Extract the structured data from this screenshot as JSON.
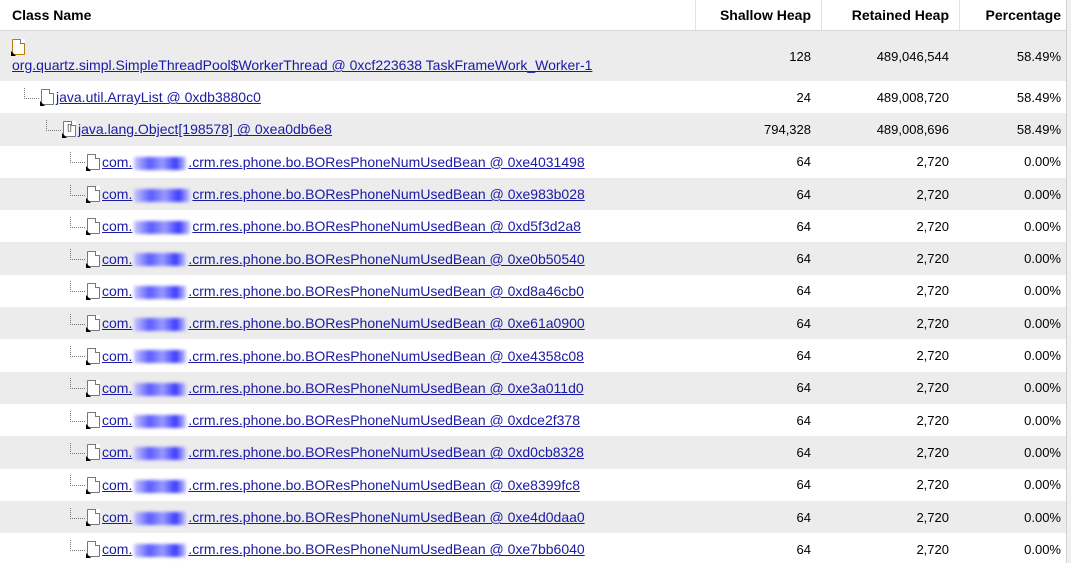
{
  "columns": {
    "class_name": "Class Name",
    "shallow_heap": "Shallow Heap",
    "retained_heap": "Retained Heap",
    "percentage": "Percentage"
  },
  "rows": [
    {
      "prefix": "",
      "name": "org.quartz.simpl.SimpleThreadPool$WorkerThread @ 0xcf223638 TaskFrameWork_Worker-1",
      "shallow": "128",
      "retained": "489,046,544",
      "percent": "58.49%"
    },
    {
      "prefix": "",
      "name": "java.util.ArrayList @ 0xdb3880c0",
      "shallow": "24",
      "retained": "489,008,720",
      "percent": "58.49%"
    },
    {
      "prefix": "",
      "name": "java.lang.Object[198578] @ 0xea0db6e8",
      "shallow": "794,328",
      "retained": "489,008,696",
      "percent": "58.49%"
    },
    {
      "prefix": "com.",
      "name": ".crm.res.phone.bo.BOResPhoneNumUsedBean @ 0xe4031498",
      "shallow": "64",
      "retained": "2,720",
      "percent": "0.00%"
    },
    {
      "prefix": "com.",
      "name": "crm.res.phone.bo.BOResPhoneNumUsedBean @ 0xe983b028",
      "shallow": "64",
      "retained": "2,720",
      "percent": "0.00%"
    },
    {
      "prefix": "com.",
      "name": "crm.res.phone.bo.BOResPhoneNumUsedBean @ 0xd5f3d2a8",
      "shallow": "64",
      "retained": "2,720",
      "percent": "0.00%"
    },
    {
      "prefix": "com.",
      "name": ".crm.res.phone.bo.BOResPhoneNumUsedBean @ 0xe0b50540",
      "shallow": "64",
      "retained": "2,720",
      "percent": "0.00%"
    },
    {
      "prefix": "com.",
      "name": ".crm.res.phone.bo.BOResPhoneNumUsedBean @ 0xd8a46cb0",
      "shallow": "64",
      "retained": "2,720",
      "percent": "0.00%"
    },
    {
      "prefix": "com.",
      "name": ".crm.res.phone.bo.BOResPhoneNumUsedBean @ 0xe61a0900",
      "shallow": "64",
      "retained": "2,720",
      "percent": "0.00%"
    },
    {
      "prefix": "com.",
      "name": ".crm.res.phone.bo.BOResPhoneNumUsedBean @ 0xe4358c08",
      "shallow": "64",
      "retained": "2,720",
      "percent": "0.00%"
    },
    {
      "prefix": "com.",
      "name": ".crm.res.phone.bo.BOResPhoneNumUsedBean @ 0xe3a011d0",
      "shallow": "64",
      "retained": "2,720",
      "percent": "0.00%"
    },
    {
      "prefix": "com.",
      "name": ".crm.res.phone.bo.BOResPhoneNumUsedBean @ 0xdce2f378",
      "shallow": "64",
      "retained": "2,720",
      "percent": "0.00%"
    },
    {
      "prefix": "com.",
      "name": ".crm.res.phone.bo.BOResPhoneNumUsedBean @ 0xd0cb8328",
      "shallow": "64",
      "retained": "2,720",
      "percent": "0.00%"
    },
    {
      "prefix": "com.",
      "name": ".crm.res.phone.bo.BOResPhoneNumUsedBean @ 0xe8399fc8",
      "shallow": "64",
      "retained": "2,720",
      "percent": "0.00%"
    },
    {
      "prefix": "com.",
      "name": ".crm.res.phone.bo.BOResPhoneNumUsedBean @ 0xe4d0daa0",
      "shallow": "64",
      "retained": "2,720",
      "percent": "0.00%"
    },
    {
      "prefix": "com.",
      "name": ".crm.res.phone.bo.BOResPhoneNumUsedBean @ 0xe7bb6040",
      "shallow": "64",
      "retained": "2,720",
      "percent": "0.00%"
    }
  ]
}
